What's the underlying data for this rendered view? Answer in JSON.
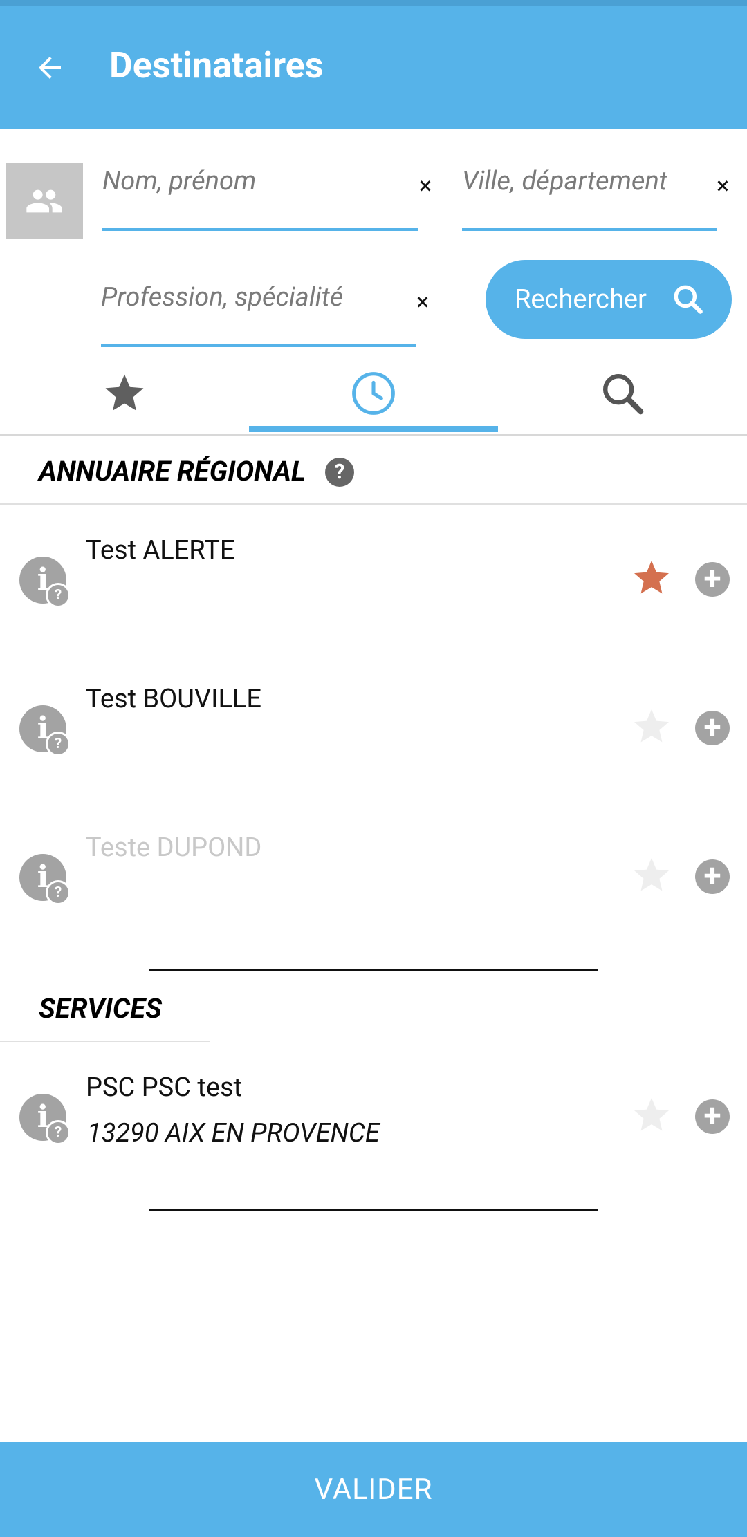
{
  "header": {
    "title": "Destinataires",
    "back_icon": "arrow-left-icon"
  },
  "search": {
    "name_placeholder": "Nom, prénom",
    "city_placeholder": "Ville, département",
    "profession_placeholder": "Profession, spécialité",
    "clear_glyph": "×",
    "button_label": "Rechercher"
  },
  "tabs": [
    {
      "icon": "star-icon",
      "selected": false
    },
    {
      "icon": "clock-icon",
      "selected": true
    },
    {
      "icon": "search-icon",
      "selected": false
    }
  ],
  "sections": {
    "regional": {
      "title": "ANNUAIRE RÉGIONAL",
      "help_glyph": "?",
      "items": [
        {
          "name": "Test ALERTE",
          "favorite": true,
          "disabled": false
        },
        {
          "name": "Test BOUVILLE",
          "favorite": false,
          "disabled": false
        },
        {
          "name": "Teste DUPOND",
          "favorite": false,
          "disabled": true
        }
      ]
    },
    "services": {
      "title": "SERVICES",
      "items": [
        {
          "name": "PSC PSC test",
          "address": "13290 AIX EN PROVENCE",
          "favorite": false
        }
      ]
    }
  },
  "glyphs": {
    "info": "i",
    "help": "?",
    "add": "+"
  },
  "footer": {
    "validate_label": "VALIDER"
  },
  "colors": {
    "accent": "#56b3e9",
    "favorite_active": "#d4704f",
    "favorite_inactive": "#eeeeee",
    "icon_grey": "#a3a3a3"
  }
}
